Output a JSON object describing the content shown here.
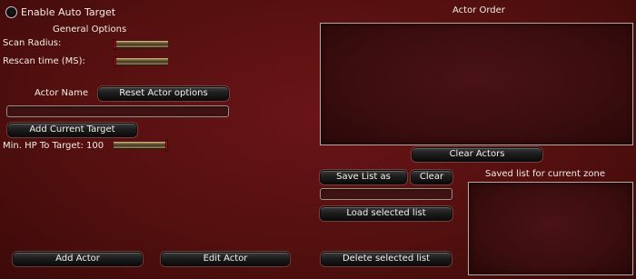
{
  "auto_target": {
    "label": "Enable Auto Target",
    "enabled": false
  },
  "general": {
    "heading": "General Options",
    "scan_radius_label": "Scan Radius:",
    "scan_radius_value": 0,
    "rescan_time_label": "Rescan time (MS):",
    "rescan_time_value": 0
  },
  "actor": {
    "name_label": "Actor Name",
    "reset_button": "Reset Actor options",
    "name_value": "",
    "add_current_target_button": "Add Current Target",
    "min_hp_label": "Min. HP To Target: 100",
    "min_hp_value": 100
  },
  "actor_order": {
    "title": "Actor Order",
    "items": [],
    "clear_button": "Clear Actors"
  },
  "lists": {
    "save_button": "Save List as",
    "clear_button": "Clear",
    "list_name_value": "",
    "load_button": "Load selected list",
    "delete_button": "Delete selected list",
    "saved_title": "Saved list for current zone",
    "saved_items": []
  },
  "footer": {
    "add_actor_button": "Add Actor",
    "edit_actor_button": "Edit Actor"
  }
}
